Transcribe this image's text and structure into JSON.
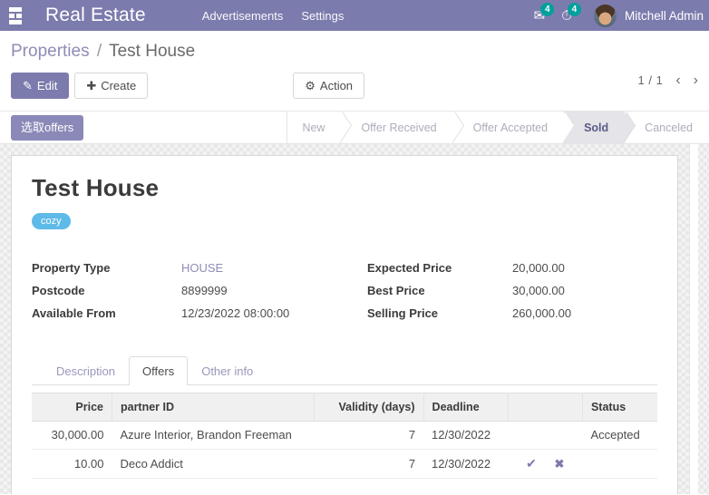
{
  "navbar": {
    "apps_icon": "apps-grid-icon",
    "brand": "Real Estate",
    "menus": [
      {
        "label": "Advertisements"
      },
      {
        "label": "Settings"
      }
    ],
    "systray": {
      "messages": {
        "icon": "messages-icon",
        "glyph": "✉",
        "count": "4"
      },
      "activities": {
        "icon": "clock-activity-icon",
        "glyph": "⏱",
        "count": "4"
      },
      "user": {
        "avatar": "user-avatar",
        "name": "Mitchell Admin"
      }
    },
    "accent_color": "#7c7bad",
    "badge_color": "#00a09d"
  },
  "control_panel": {
    "breadcrumb": {
      "parent": "Properties",
      "separator": "/",
      "current": "Test House"
    },
    "buttons": {
      "edit": {
        "label": "Edit",
        "icon": "pencil-icon",
        "glyph": "✎"
      },
      "create": {
        "label": "Create",
        "icon": "plus-icon",
        "glyph": "✚"
      },
      "action": {
        "label": "Action",
        "icon": "gear-icon",
        "glyph": "⚙"
      }
    },
    "pager": {
      "value": "1 / 1",
      "prev": "‹",
      "next": "›"
    }
  },
  "statusbar": {
    "button": {
      "label": "选取offers"
    },
    "steps": [
      {
        "label": "New",
        "active": false
      },
      {
        "label": "Offer Received",
        "active": false
      },
      {
        "label": "Offer Accepted",
        "active": false
      },
      {
        "label": "Sold",
        "active": true
      },
      {
        "label": "Canceled",
        "active": false
      }
    ]
  },
  "record": {
    "title": "Test House",
    "tags": [
      {
        "label": "cozy",
        "color": "#5ebae8"
      }
    ],
    "fields_left": [
      {
        "label": "Property Type",
        "value": "HOUSE",
        "is_link": true
      },
      {
        "label": "Postcode",
        "value": "8899999",
        "is_link": false
      },
      {
        "label": "Available From",
        "value": "12/23/2022 08:00:00",
        "is_link": false
      }
    ],
    "fields_right": [
      {
        "label": "Expected Price",
        "value": "20,000.00"
      },
      {
        "label": "Best Price",
        "value": "30,000.00"
      },
      {
        "label": "Selling Price",
        "value": "260,000.00"
      }
    ]
  },
  "notebook": {
    "tabs": [
      {
        "label": "Description",
        "active": false
      },
      {
        "label": "Offers",
        "active": true
      },
      {
        "label": "Other info",
        "active": false
      }
    ]
  },
  "offers_table": {
    "columns": [
      {
        "label": "Price",
        "align": "right"
      },
      {
        "label": "partner ID",
        "align": "left"
      },
      {
        "label": "Validity  (days)",
        "align": "right"
      },
      {
        "label": "Deadline",
        "align": "left"
      },
      {
        "label": "",
        "align": "center"
      },
      {
        "label": "Status",
        "align": "left"
      }
    ],
    "rows": [
      {
        "price": "30,000.00",
        "partner": "Azure Interior, Brandon Freeman",
        "validity": "7",
        "deadline": "12/30/2022",
        "confirm_icon": "",
        "refuse_icon": "",
        "status": "Accepted"
      },
      {
        "price": "10.00",
        "partner": "Deco Addict",
        "validity": "7",
        "deadline": "12/30/2022",
        "confirm_icon": "✔",
        "refuse_icon": "✖",
        "status": ""
      }
    ]
  }
}
